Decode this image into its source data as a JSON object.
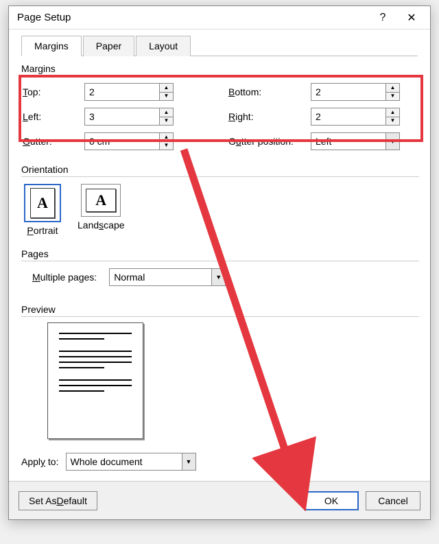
{
  "title": "Page Setup",
  "titlebar": {
    "help": "?",
    "close": "✕"
  },
  "tabs": [
    "Margins",
    "Paper",
    "Layout"
  ],
  "active_tab": 0,
  "margins": {
    "section": "Margins",
    "top": {
      "label": "Top:",
      "value": "2"
    },
    "bottom": {
      "label": "Bottom:",
      "value": "2"
    },
    "left": {
      "label": "Left:",
      "value": "3"
    },
    "right": {
      "label": "Right:",
      "value": "2"
    },
    "gutter": {
      "label": "Gutter:",
      "value": "0 cm"
    },
    "gutter_pos": {
      "label": "Gutter position:",
      "value": "Left"
    }
  },
  "orientation": {
    "section": "Orientation",
    "portrait": "Portrait",
    "landscape": "Landscape",
    "glyph": "A",
    "selected": "portrait"
  },
  "pages": {
    "section": "Pages",
    "multiple_label": "Multiple pages:",
    "value": "Normal"
  },
  "preview": {
    "section": "Preview"
  },
  "apply": {
    "label": "Apply to:",
    "value": "Whole document"
  },
  "buttons": {
    "set_default": "Set As Default",
    "ok": "OK",
    "cancel": "Cancel"
  },
  "annotation": {
    "highlight": {
      "target": "margins-inputs",
      "color": "#e4373f"
    },
    "arrow": {
      "from": "gutter-spinner",
      "to": "ok-button",
      "color": "#e4373f"
    }
  }
}
